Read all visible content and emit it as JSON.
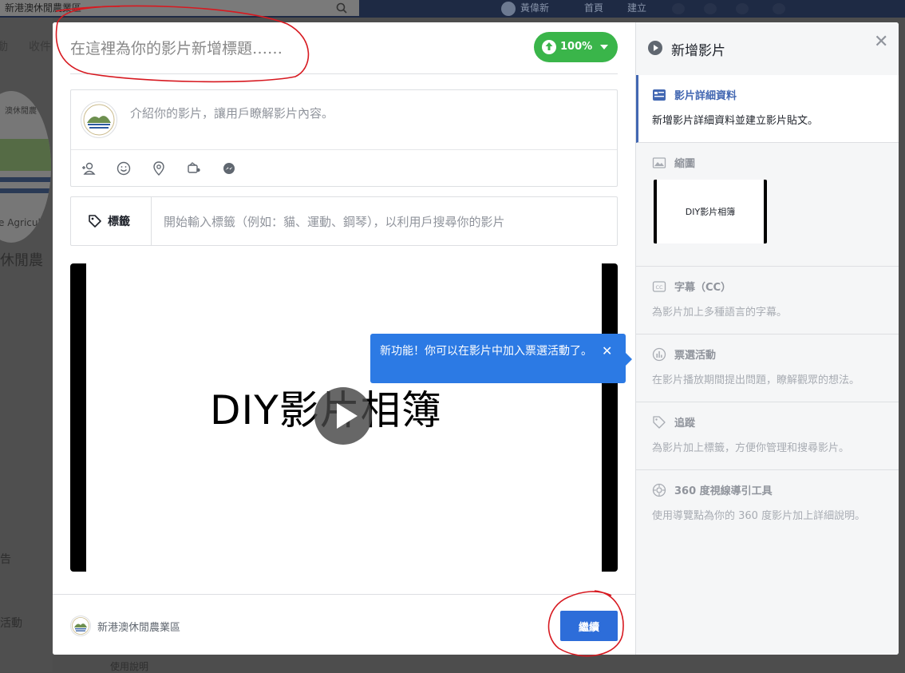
{
  "background": {
    "search_text": "新港澳休閒農業區",
    "user_name": "黃偉新",
    "nav_home": "首頁",
    "nav_create": "建立",
    "tab_1": "動",
    "tab_2": "收件",
    "logo_letters": "澳休閒農",
    "logo_curve_text": "e Agricul",
    "page_name": "休閒農",
    "side_item_1": "告",
    "side_item_2": "活動",
    "help_link": "使用說明"
  },
  "modal": {
    "title_placeholder": "在這裡為你的影片新增標題……",
    "upload_percent": "100%",
    "description_placeholder": "介紹你的影片，讓用戶瞭解影片內容。",
    "tags_label": "標籤",
    "tags_placeholder": "開始輸入標籤（例如：貓、運動、鋼琴），以利用戶搜尋你的影片",
    "video_text": "DIY影片相簿",
    "tooltip_text": "新功能！你可以在影片中加入票選活動了。",
    "tooltip_close": "✕",
    "footer_page_name": "新港澳休閒農業區",
    "continue_label": "繼續"
  },
  "sidebar": {
    "title": "新增影片",
    "close": "✕",
    "steps": [
      {
        "title": "影片詳細資料",
        "desc": "新增影片詳細資料並建立影片貼文。",
        "icon": "details-icon",
        "active": true
      },
      {
        "title": "縮圖",
        "thumb_text": "DIY影片相簿",
        "icon": "image-icon"
      },
      {
        "title": "字幕（CC）",
        "desc": "為影片加上多種語言的字幕。",
        "icon": "captions-icon"
      },
      {
        "title": "票選活動",
        "desc": "在影片播放期間提出問題，瞭解觀眾的想法。",
        "icon": "poll-icon"
      },
      {
        "title": "追蹤",
        "desc": "為影片加上標籤，方便你管理和搜尋影片。",
        "icon": "tag-icon"
      },
      {
        "title": "360 度視線導引工具",
        "desc": "使用導覽點為你的 360 度影片加上詳細說明。",
        "icon": "guide-360-icon"
      }
    ]
  },
  "colors": {
    "accent": "#4267b2",
    "upload_green": "#3ab54a",
    "tooltip_blue": "#2c7ae4",
    "continue_blue": "#2d6dd9",
    "annotation_red": "#d71920"
  }
}
